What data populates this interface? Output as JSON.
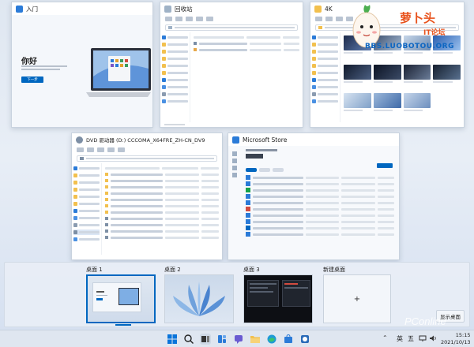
{
  "windows": {
    "intro": {
      "title": "入门",
      "heading": "你好",
      "button": "下一步"
    },
    "recycle": {
      "title": "回收站"
    },
    "fourk": {
      "title": "4K"
    },
    "dvd": {
      "title": "DVD 驱动器 (D:) CCCOMA_X64FRE_ZH-CN_DV9"
    },
    "store": {
      "title": "Microsoft Store"
    }
  },
  "watermark": {
    "brand_cn": "萝卜头",
    "brand_sub": "IT论坛",
    "url": "BBS.LUOBOTOU.ORG"
  },
  "desktops": {
    "items": [
      {
        "label": "桌面 1"
      },
      {
        "label": "桌面 2"
      },
      {
        "label": "桌面 3"
      }
    ],
    "new_label": "新建桌面",
    "new_symbol": "+",
    "show_desktop": "显示桌面"
  },
  "pconline": "PConline",
  "tray": {
    "ime": "英",
    "ime2": "五",
    "time": "15:15",
    "date": "2021/10/13"
  },
  "colors": {
    "accent": "#0067c0",
    "folder": "#f2c04e"
  }
}
